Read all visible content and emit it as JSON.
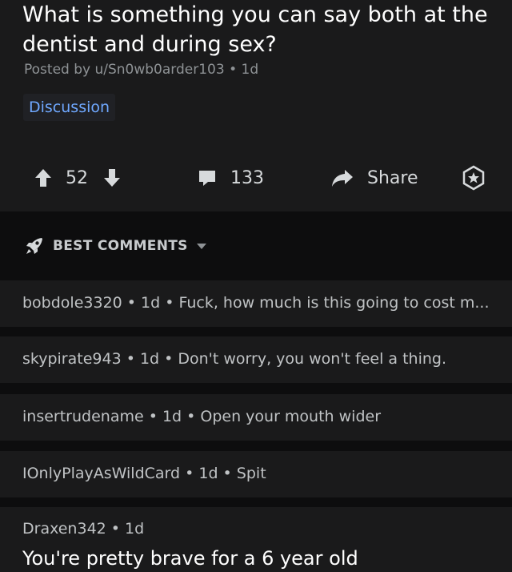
{
  "post": {
    "title": "What is something you can say both at the dentist and during sex?",
    "meta": "Posted by u/Sn0wb0arder103 • 1d",
    "flair": "Discussion",
    "score": "52",
    "comment_count": "133",
    "share_label": "Share"
  },
  "sort": {
    "label": "BEST COMMENTS"
  },
  "comments": [
    {
      "line": "bobdole3320 • 1d • Fuck, how much is this going to cost m..."
    },
    {
      "line": "skypirate943 • 1d • Don't worry, you won't feel a thing."
    },
    {
      "line": "insertrudename • 1d • Open your mouth wider"
    },
    {
      "line": "IOnlyPlayAsWildCard • 1d • Spit"
    },
    {
      "line": "Draxen342 • 1d",
      "body": "You're pretty brave for a 6 year old"
    }
  ],
  "colors": {
    "background": "#0d0d0e",
    "card": "#1a1a1b",
    "flair_text": "#6fa8ff",
    "text": "#d7dadc"
  },
  "icons": [
    "upvote-arrow-icon",
    "downvote-arrow-icon",
    "comment-bubble-icon",
    "share-arrow-icon",
    "award-star-icon",
    "rocket-icon",
    "caret-down-icon"
  ]
}
